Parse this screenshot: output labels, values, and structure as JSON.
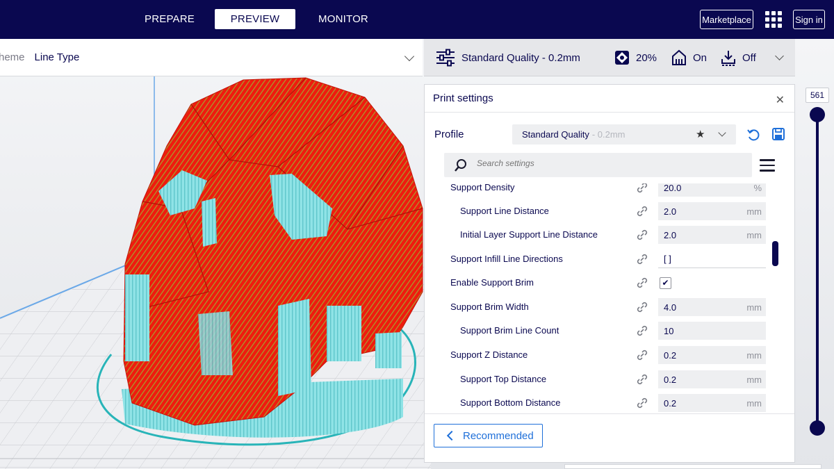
{
  "topbar": {
    "tabs": [
      {
        "label": "PREPARE",
        "active": false
      },
      {
        "label": "PREVIEW",
        "active": true
      },
      {
        "label": "MONITOR",
        "active": false
      }
    ],
    "marketplace_label": "Marketplace",
    "signin_label": "Sign in",
    "apps_icon": "grid-apps-icon"
  },
  "color_scheme": {
    "label": "heme",
    "value": "Line Type"
  },
  "quality_bar": {
    "profile": "Standard Quality - 0.2mm",
    "infill": "20%",
    "support": "On",
    "adhesion": "Off"
  },
  "print_settings": {
    "title": "Print settings",
    "profile_label": "Profile",
    "profile_name": "Standard Quality",
    "profile_suffix": "- 0.2mm",
    "search_placeholder": "Search settings",
    "settings": [
      {
        "label": "Support Density",
        "value": "20.0",
        "unit": "%",
        "indent": 0
      },
      {
        "label": "Support Line Distance",
        "value": "2.0",
        "unit": "mm",
        "indent": 1
      },
      {
        "label": "Initial Layer Support Line Distance",
        "value": "2.0",
        "unit": "mm",
        "indent": 1
      },
      {
        "label": "Support Infill Line Directions",
        "value": "[ ]",
        "unit": "",
        "indent": 0
      },
      {
        "label": "Enable Support Brim",
        "value": "✔",
        "unit": "",
        "indent": 0
      },
      {
        "label": "Support Brim Width",
        "value": "4.0",
        "unit": "mm",
        "indent": 0
      },
      {
        "label": "Support Brim Line Count",
        "value": "10",
        "unit": "",
        "indent": 1
      },
      {
        "label": "Support Z Distance",
        "value": "0.2",
        "unit": "mm",
        "indent": 0
      },
      {
        "label": "Support Top Distance",
        "value": "0.2",
        "unit": "mm",
        "indent": 1
      },
      {
        "label": "Support Bottom Distance",
        "value": "0.2",
        "unit": "mm",
        "indent": 1
      }
    ],
    "recommended_label": "Recommended"
  },
  "layer_slider": {
    "current_layer": "561"
  },
  "colors": {
    "nav_bg": "#0a0850",
    "model_red": "#ee1c0e",
    "support_cyan": "#8fe3e6",
    "accent_blue": "#1e6fd9"
  }
}
